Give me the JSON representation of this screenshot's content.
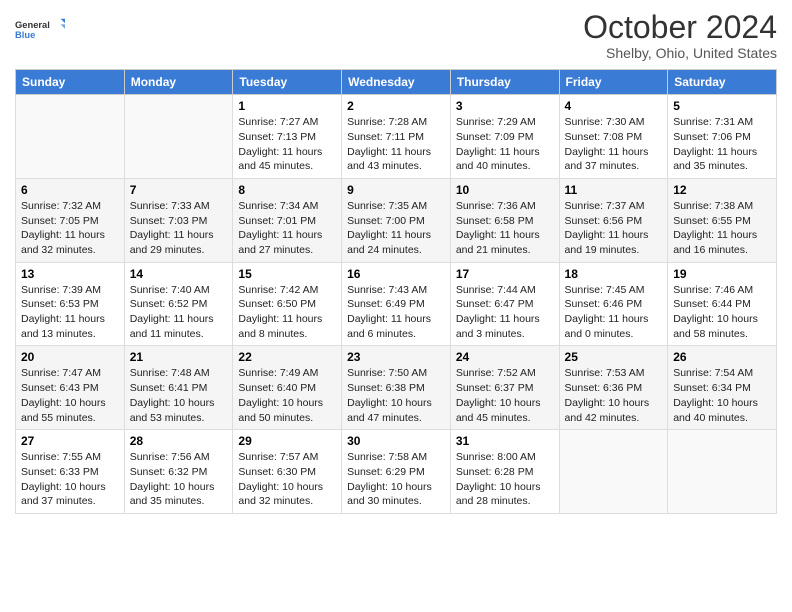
{
  "header": {
    "logo_general": "General",
    "logo_blue": "Blue",
    "title": "October 2024",
    "subtitle": "Shelby, Ohio, United States"
  },
  "weekdays": [
    "Sunday",
    "Monday",
    "Tuesday",
    "Wednesday",
    "Thursday",
    "Friday",
    "Saturday"
  ],
  "weeks": [
    [
      {
        "day": "",
        "info": ""
      },
      {
        "day": "",
        "info": ""
      },
      {
        "day": "1",
        "info": "Sunrise: 7:27 AM\nSunset: 7:13 PM\nDaylight: 11 hours and 45 minutes."
      },
      {
        "day": "2",
        "info": "Sunrise: 7:28 AM\nSunset: 7:11 PM\nDaylight: 11 hours and 43 minutes."
      },
      {
        "day": "3",
        "info": "Sunrise: 7:29 AM\nSunset: 7:09 PM\nDaylight: 11 hours and 40 minutes."
      },
      {
        "day": "4",
        "info": "Sunrise: 7:30 AM\nSunset: 7:08 PM\nDaylight: 11 hours and 37 minutes."
      },
      {
        "day": "5",
        "info": "Sunrise: 7:31 AM\nSunset: 7:06 PM\nDaylight: 11 hours and 35 minutes."
      }
    ],
    [
      {
        "day": "6",
        "info": "Sunrise: 7:32 AM\nSunset: 7:05 PM\nDaylight: 11 hours and 32 minutes."
      },
      {
        "day": "7",
        "info": "Sunrise: 7:33 AM\nSunset: 7:03 PM\nDaylight: 11 hours and 29 minutes."
      },
      {
        "day": "8",
        "info": "Sunrise: 7:34 AM\nSunset: 7:01 PM\nDaylight: 11 hours and 27 minutes."
      },
      {
        "day": "9",
        "info": "Sunrise: 7:35 AM\nSunset: 7:00 PM\nDaylight: 11 hours and 24 minutes."
      },
      {
        "day": "10",
        "info": "Sunrise: 7:36 AM\nSunset: 6:58 PM\nDaylight: 11 hours and 21 minutes."
      },
      {
        "day": "11",
        "info": "Sunrise: 7:37 AM\nSunset: 6:56 PM\nDaylight: 11 hours and 19 minutes."
      },
      {
        "day": "12",
        "info": "Sunrise: 7:38 AM\nSunset: 6:55 PM\nDaylight: 11 hours and 16 minutes."
      }
    ],
    [
      {
        "day": "13",
        "info": "Sunrise: 7:39 AM\nSunset: 6:53 PM\nDaylight: 11 hours and 13 minutes."
      },
      {
        "day": "14",
        "info": "Sunrise: 7:40 AM\nSunset: 6:52 PM\nDaylight: 11 hours and 11 minutes."
      },
      {
        "day": "15",
        "info": "Sunrise: 7:42 AM\nSunset: 6:50 PM\nDaylight: 11 hours and 8 minutes."
      },
      {
        "day": "16",
        "info": "Sunrise: 7:43 AM\nSunset: 6:49 PM\nDaylight: 11 hours and 6 minutes."
      },
      {
        "day": "17",
        "info": "Sunrise: 7:44 AM\nSunset: 6:47 PM\nDaylight: 11 hours and 3 minutes."
      },
      {
        "day": "18",
        "info": "Sunrise: 7:45 AM\nSunset: 6:46 PM\nDaylight: 11 hours and 0 minutes."
      },
      {
        "day": "19",
        "info": "Sunrise: 7:46 AM\nSunset: 6:44 PM\nDaylight: 10 hours and 58 minutes."
      }
    ],
    [
      {
        "day": "20",
        "info": "Sunrise: 7:47 AM\nSunset: 6:43 PM\nDaylight: 10 hours and 55 minutes."
      },
      {
        "day": "21",
        "info": "Sunrise: 7:48 AM\nSunset: 6:41 PM\nDaylight: 10 hours and 53 minutes."
      },
      {
        "day": "22",
        "info": "Sunrise: 7:49 AM\nSunset: 6:40 PM\nDaylight: 10 hours and 50 minutes."
      },
      {
        "day": "23",
        "info": "Sunrise: 7:50 AM\nSunset: 6:38 PM\nDaylight: 10 hours and 47 minutes."
      },
      {
        "day": "24",
        "info": "Sunrise: 7:52 AM\nSunset: 6:37 PM\nDaylight: 10 hours and 45 minutes."
      },
      {
        "day": "25",
        "info": "Sunrise: 7:53 AM\nSunset: 6:36 PM\nDaylight: 10 hours and 42 minutes."
      },
      {
        "day": "26",
        "info": "Sunrise: 7:54 AM\nSunset: 6:34 PM\nDaylight: 10 hours and 40 minutes."
      }
    ],
    [
      {
        "day": "27",
        "info": "Sunrise: 7:55 AM\nSunset: 6:33 PM\nDaylight: 10 hours and 37 minutes."
      },
      {
        "day": "28",
        "info": "Sunrise: 7:56 AM\nSunset: 6:32 PM\nDaylight: 10 hours and 35 minutes."
      },
      {
        "day": "29",
        "info": "Sunrise: 7:57 AM\nSunset: 6:30 PM\nDaylight: 10 hours and 32 minutes."
      },
      {
        "day": "30",
        "info": "Sunrise: 7:58 AM\nSunset: 6:29 PM\nDaylight: 10 hours and 30 minutes."
      },
      {
        "day": "31",
        "info": "Sunrise: 8:00 AM\nSunset: 6:28 PM\nDaylight: 10 hours and 28 minutes."
      },
      {
        "day": "",
        "info": ""
      },
      {
        "day": "",
        "info": ""
      }
    ]
  ]
}
